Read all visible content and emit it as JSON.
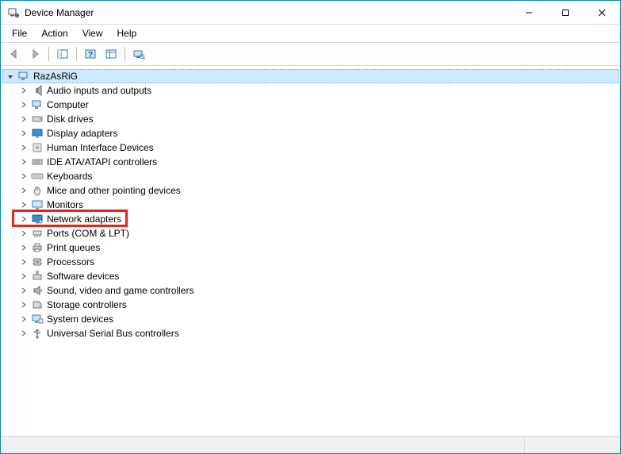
{
  "window": {
    "title": "Device Manager"
  },
  "menu": {
    "file": "File",
    "action": "Action",
    "view": "View",
    "help": "Help"
  },
  "tree": {
    "root": {
      "label": "RazAsRiG",
      "expanded": true
    },
    "items": [
      {
        "label": "Audio inputs and outputs",
        "icon": "audio"
      },
      {
        "label": "Computer",
        "icon": "computer"
      },
      {
        "label": "Disk drives",
        "icon": "disk"
      },
      {
        "label": "Display adapters",
        "icon": "display"
      },
      {
        "label": "Human Interface Devices",
        "icon": "hid"
      },
      {
        "label": "IDE ATA/ATAPI controllers",
        "icon": "ide"
      },
      {
        "label": "Keyboards",
        "icon": "keyboard"
      },
      {
        "label": "Mice and other pointing devices",
        "icon": "mouse"
      },
      {
        "label": "Monitors",
        "icon": "monitor"
      },
      {
        "label": "Network adapters",
        "icon": "network",
        "highlighted": true
      },
      {
        "label": "Ports (COM & LPT)",
        "icon": "port"
      },
      {
        "label": "Print queues",
        "icon": "printer"
      },
      {
        "label": "Processors",
        "icon": "cpu"
      },
      {
        "label": "Software devices",
        "icon": "software"
      },
      {
        "label": "Sound, video and game controllers",
        "icon": "sound"
      },
      {
        "label": "Storage controllers",
        "icon": "storage"
      },
      {
        "label": "System devices",
        "icon": "system"
      },
      {
        "label": "Universal Serial Bus controllers",
        "icon": "usb"
      }
    ]
  },
  "highlight_color": "#e8231a"
}
